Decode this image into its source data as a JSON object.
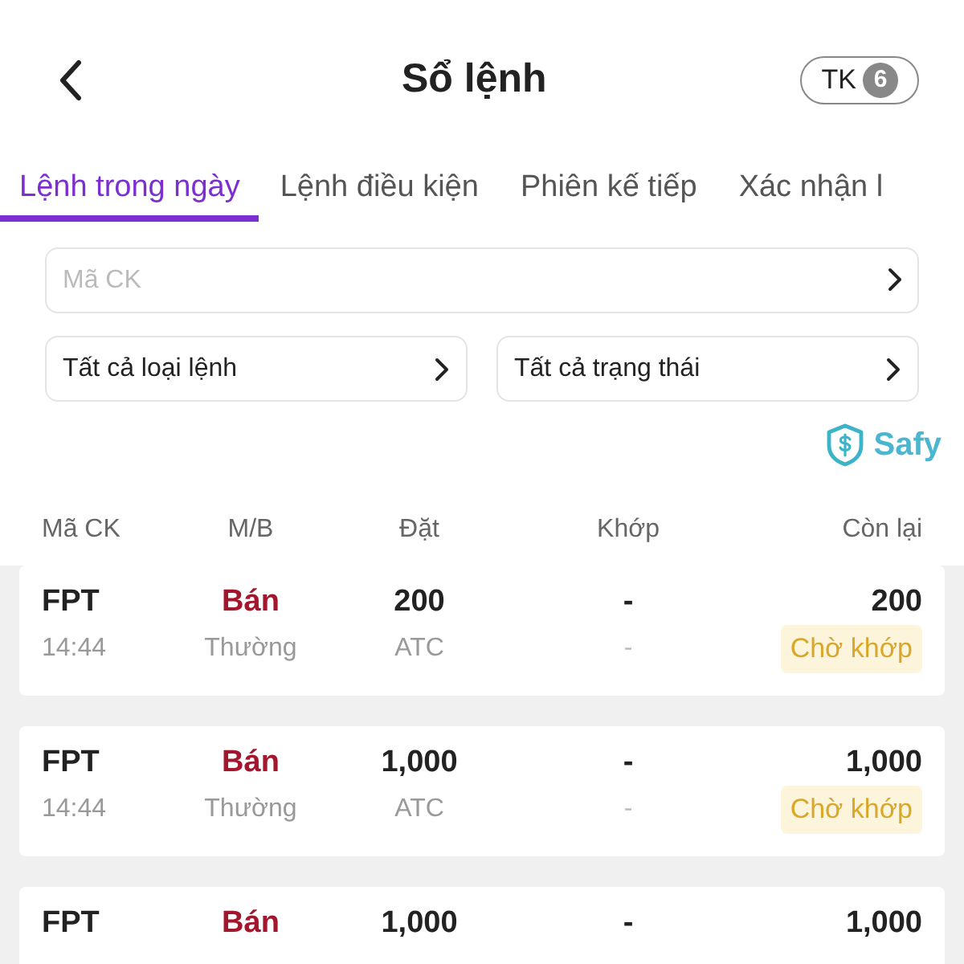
{
  "header": {
    "title": "Sổ lệnh",
    "account_label": "TK",
    "account_count": "6"
  },
  "tabs": [
    {
      "label": "Lệnh trong ngày",
      "selected": true
    },
    {
      "label": "Lệnh điều kiện",
      "selected": false
    },
    {
      "label": "Phiên kế tiếp",
      "selected": false
    },
    {
      "label": "Xác nhận l",
      "selected": false
    }
  ],
  "filters": {
    "symbol_placeholder": "Mã CK",
    "order_type": "Tất cả loại lệnh",
    "status": "Tất cả trạng thái"
  },
  "brand": "Safy",
  "table": {
    "columns": [
      "Mã CK",
      "M/B",
      "Đặt",
      "Khớp",
      "Còn lại"
    ],
    "rows": [
      {
        "symbol": "FPT",
        "side": "Bán",
        "quantity": "200",
        "matched": "-",
        "remaining": "200",
        "time": "14:44",
        "order_type": "Thường",
        "price": "ATC",
        "matched_price": "-",
        "status": "Chờ khớp"
      },
      {
        "symbol": "FPT",
        "side": "Bán",
        "quantity": "1,000",
        "matched": "-",
        "remaining": "1,000",
        "time": "14:44",
        "order_type": "Thường",
        "price": "ATC",
        "matched_price": "-",
        "status": "Chờ khớp"
      },
      {
        "symbol": "FPT",
        "side": "Bán",
        "quantity": "1,000",
        "matched": "-",
        "remaining": "1,000"
      }
    ]
  }
}
